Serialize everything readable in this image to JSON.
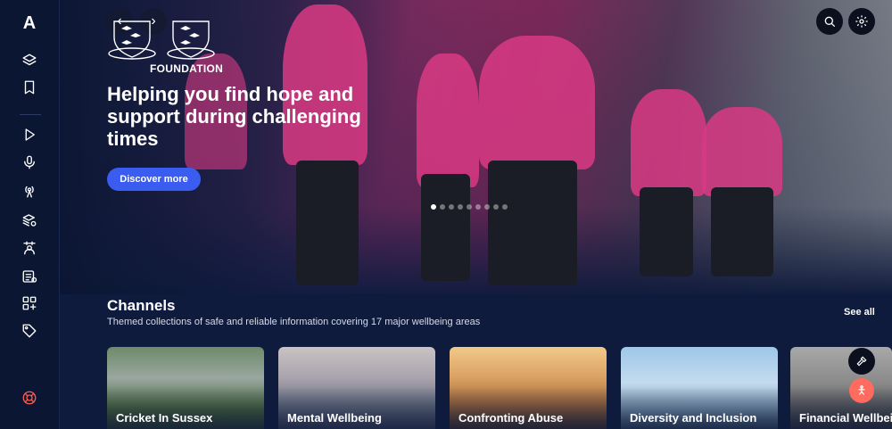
{
  "app": {
    "logo": "A"
  },
  "sidebar": {
    "icons": [
      "layers-icon",
      "bookmark-icon",
      "play-icon",
      "microphone-icon",
      "broadcast-icon",
      "stack-settings-icon",
      "user-badge-icon",
      "article-icon",
      "apps-add-icon",
      "tag-icon",
      "help-icon"
    ]
  },
  "hero": {
    "foundation_label": "FOUNDATION",
    "title": "Helping you find hope and support during challenging times",
    "cta_label": "Discover more",
    "slide_count": 9,
    "active_slide": 1,
    "prev_icon": "chevron-left-icon",
    "next_icon": "chevron-right-icon"
  },
  "header": {
    "search_icon": "search-icon",
    "settings_icon": "gear-icon"
  },
  "channels": {
    "title": "Channels",
    "subtitle": "Themed collections of safe and reliable information covering 17 major wellbeing areas",
    "see_all": "See all",
    "cards": [
      {
        "label": "Cricket In Sussex"
      },
      {
        "label": "Mental Wellbeing"
      },
      {
        "label": "Confronting Abuse"
      },
      {
        "label": "Diversity and Inclusion"
      },
      {
        "label": "Financial Wellbeing"
      }
    ]
  },
  "colors": {
    "accent": "#3a5cf0",
    "sidebar_bg": "#0b1633",
    "page_bg": "#0f1b3d",
    "help": "#ff5a4f"
  }
}
